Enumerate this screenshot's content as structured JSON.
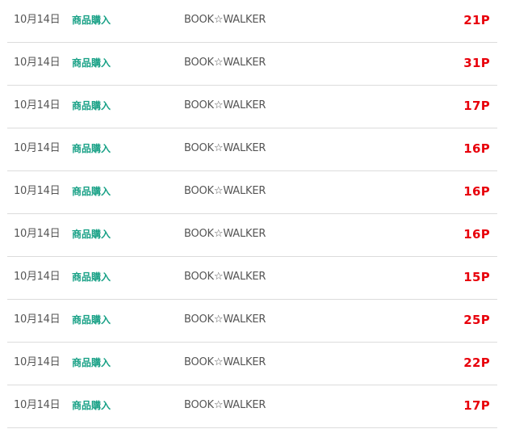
{
  "history": {
    "rows": [
      {
        "date": "10月14日",
        "type": "商品購入",
        "shop": "BOOK☆WALKER",
        "points": "21P"
      },
      {
        "date": "10月14日",
        "type": "商品購入",
        "shop": "BOOK☆WALKER",
        "points": "31P"
      },
      {
        "date": "10月14日",
        "type": "商品購入",
        "shop": "BOOK☆WALKER",
        "points": "17P"
      },
      {
        "date": "10月14日",
        "type": "商品購入",
        "shop": "BOOK☆WALKER",
        "points": "16P"
      },
      {
        "date": "10月14日",
        "type": "商品購入",
        "shop": "BOOK☆WALKER",
        "points": "16P"
      },
      {
        "date": "10月14日",
        "type": "商品購入",
        "shop": "BOOK☆WALKER",
        "points": "16P"
      },
      {
        "date": "10月14日",
        "type": "商品購入",
        "shop": "BOOK☆WALKER",
        "points": "15P"
      },
      {
        "date": "10月14日",
        "type": "商品購入",
        "shop": "BOOK☆WALKER",
        "points": "25P"
      },
      {
        "date": "10月14日",
        "type": "商品購入",
        "shop": "BOOK☆WALKER",
        "points": "22P"
      },
      {
        "date": "10月14日",
        "type": "商品購入",
        "shop": "BOOK☆WALKER",
        "points": "17P"
      }
    ]
  },
  "colors": {
    "type_label": "#16a085",
    "points": "#e8000b",
    "text": "#555555",
    "divider": "#dcdcdc"
  }
}
